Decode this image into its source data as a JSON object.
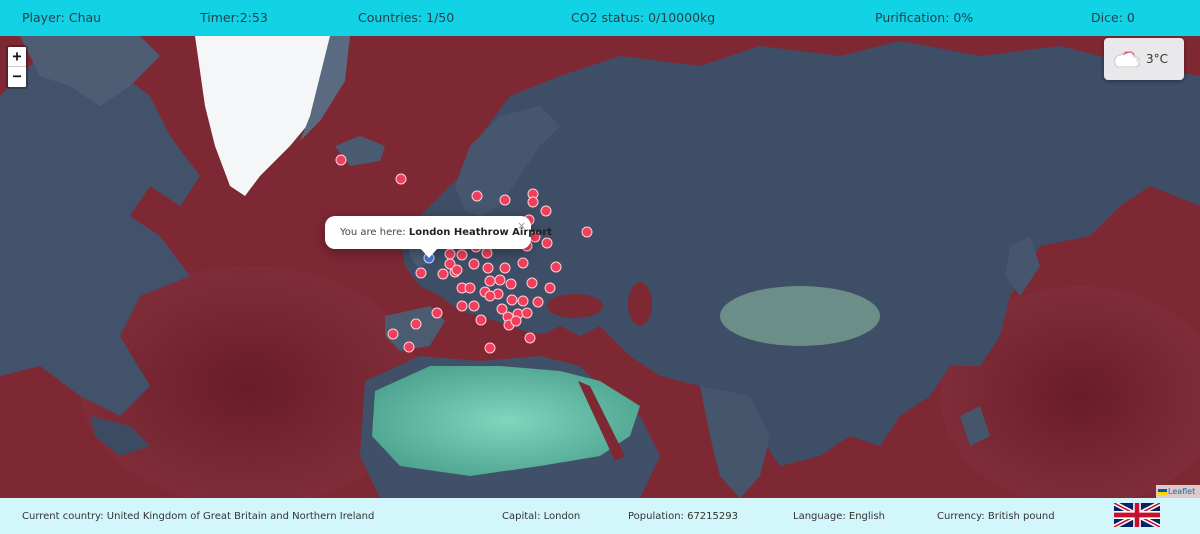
{
  "status_bar": {
    "player": "Player: Chau",
    "timer": "Timer:2:53",
    "countries": "Countries: 1/50",
    "co2": "CO2 status: 0/10000kg",
    "purification": "Purification: 0%",
    "dice": "Dice: 0"
  },
  "map": {
    "zoom_in_label": "+",
    "zoom_out_label": "−",
    "weather": {
      "icon": "cloud-icon",
      "temperature": "3°C"
    },
    "popup": {
      "prefix": "You are here: ",
      "location": "London Heathrow Airport",
      "close_label": "×"
    },
    "attribution": "Leaflet",
    "colors": {
      "ocean": "#7d2633",
      "land": "#3f4f63",
      "desert": "#5fb8a2",
      "ice": "#ffffff",
      "marker": "#f0405e",
      "current_marker": "#4e72c9"
    }
  },
  "info_bar": {
    "country": "Current country: United Kingdom of Great Britain and Northern Ireland",
    "capital": "Capital: London",
    "population": "Population: 67215293",
    "language": "Language: English",
    "currency": "Currency: British pound",
    "flag": "uk-flag-icon"
  }
}
